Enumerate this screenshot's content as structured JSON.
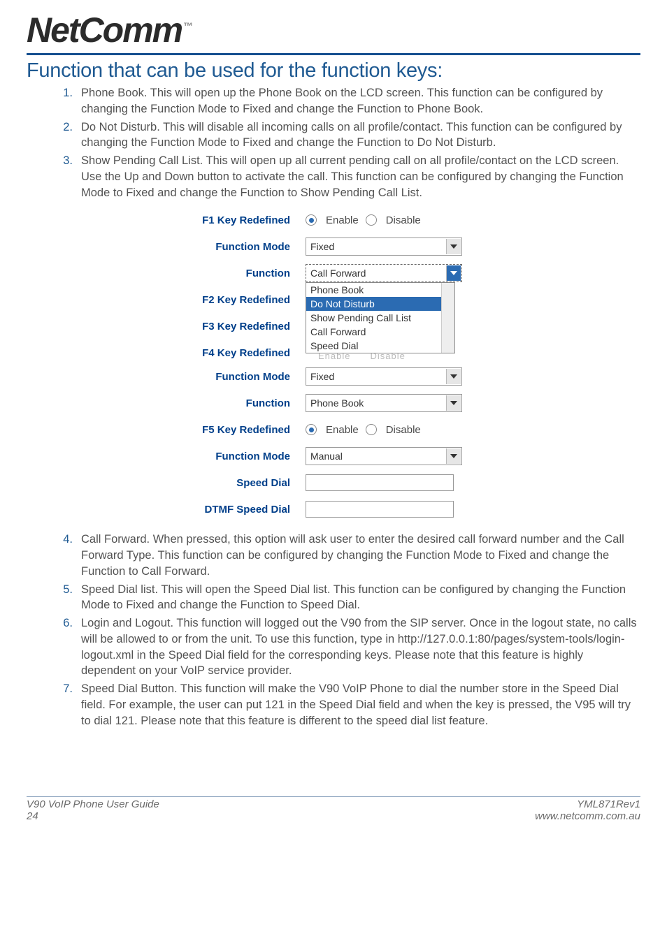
{
  "header": {
    "brand": "NetComm",
    "tm": "™"
  },
  "title": "Function that can be used for the function keys:",
  "list_top": [
    {
      "n": "1.",
      "text": "Phone Book. This will open up the Phone Book on the LCD screen. This function can be configured by changing the Function Mode to Fixed and change the Function to Phone Book."
    },
    {
      "n": "2.",
      "text": "Do Not Disturb. This will disable all incoming calls on all profile/contact. This function can be configured by changing the Function Mode to Fixed and change the Function to Do Not Disturb."
    },
    {
      "n": "3.",
      "text": "Show Pending Call List. This will open up all current pending call on all profile/contact on the LCD screen. Use the Up and Down button to activate the call. This function can be configured by changing the Function Mode to Fixed and change the Function to Show Pending Call List."
    }
  ],
  "form": {
    "f1_label": "F1 Key Redefined",
    "f1_radio_enable": "Enable",
    "f1_radio_disable": "Disable",
    "function_mode_label": "Function Mode",
    "function_mode_value_fixed": "Fixed",
    "function_label": "Function",
    "function_value_callforward": "Call Forward",
    "dropdown_options": [
      "Phone Book",
      "Do Not Disturb",
      "Show Pending Call List",
      "Call Forward",
      "Speed Dial"
    ],
    "f2_label": "F2 Key Redefined",
    "f3_label": "F3 Key Redefined",
    "f4_label": "F4 Key Redefined",
    "function_value_phonebook": "Phone Book",
    "f5_label": "F5 Key Redefined",
    "function_mode_value_manual": "Manual",
    "speed_dial_label": "Speed Dial",
    "dtmf_speed_dial_label": "DTMF Speed Dial",
    "faded_enable": "Enable",
    "faded_disable": "Disable"
  },
  "list_bottom": [
    {
      "n": "4.",
      "text": "Call Forward. When pressed, this option will ask user to enter the desired call forward number and the Call Forward Type. This function can be configured by changing the Function Mode to Fixed and change the Function to Call Forward."
    },
    {
      "n": "5.",
      "text": "Speed Dial list. This will open the Speed Dial list. This function can be configured by changing the Function Mode to Fixed and change the Function to Speed Dial."
    },
    {
      "n": "6.",
      "text": "Login and Logout. This function will logged out the V90 from the SIP server. Once in the logout state, no calls will be allowed to or from the unit. To use this function, type in http://127.0.0.1:80/pages/system-tools/login-logout.xml in the Speed Dial field for the corresponding keys. Please note that this feature is highly dependent on your VoIP service provider."
    },
    {
      "n": "7.",
      "text": "Speed Dial Button. This function will make the V90 VoIP Phone to dial the number store in the Speed Dial field. For example, the user can put 121 in the Speed Dial field and when the key is pressed, the V95 will try to dial 121. Please note that this feature is different to the speed dial list feature."
    }
  ],
  "footer": {
    "left1": "V90 VoIP Phone User Guide",
    "left2": "24",
    "right1": "YML871Rev1",
    "right2": "www.netcomm.com.au"
  }
}
